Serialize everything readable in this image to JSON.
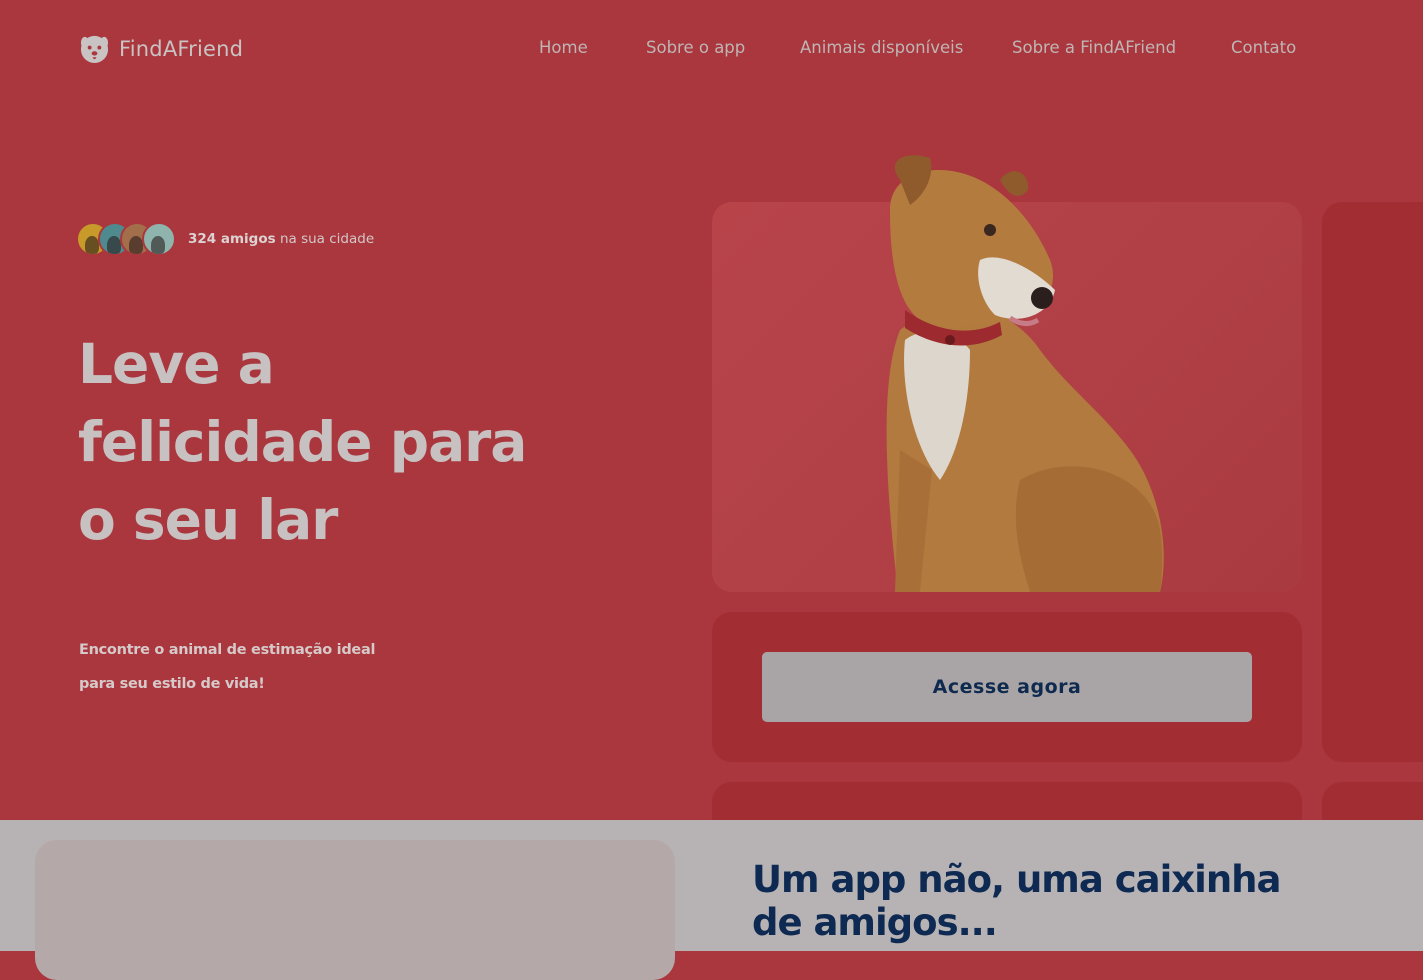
{
  "brand": {
    "name": "FindAFriend",
    "logo_icon": "dog-face-icon"
  },
  "nav": {
    "items": [
      {
        "label": "Home"
      },
      {
        "label": "Sobre o app"
      },
      {
        "label": "Animais disponíveis"
      },
      {
        "label": "Sobre a FindAFriend"
      },
      {
        "label": "Contato"
      }
    ]
  },
  "hero": {
    "friends_count": "324 amigos",
    "friends_suffix": " na sua cidade",
    "headline": "Leve a felicidade para o seu lar",
    "subtitle_line1": "Encontre o animal de estimação ideal",
    "subtitle_line2": "para seu estilo de vida!",
    "cta_label": "Acesse agora"
  },
  "about": {
    "title": "Um app não, uma caixinha de amigos..."
  },
  "colors": {
    "hero_bg": "#aa373d",
    "card_bg": "#a22d33",
    "cta_text": "#0f2a4f",
    "lower_bg": "#b7b3b4"
  }
}
